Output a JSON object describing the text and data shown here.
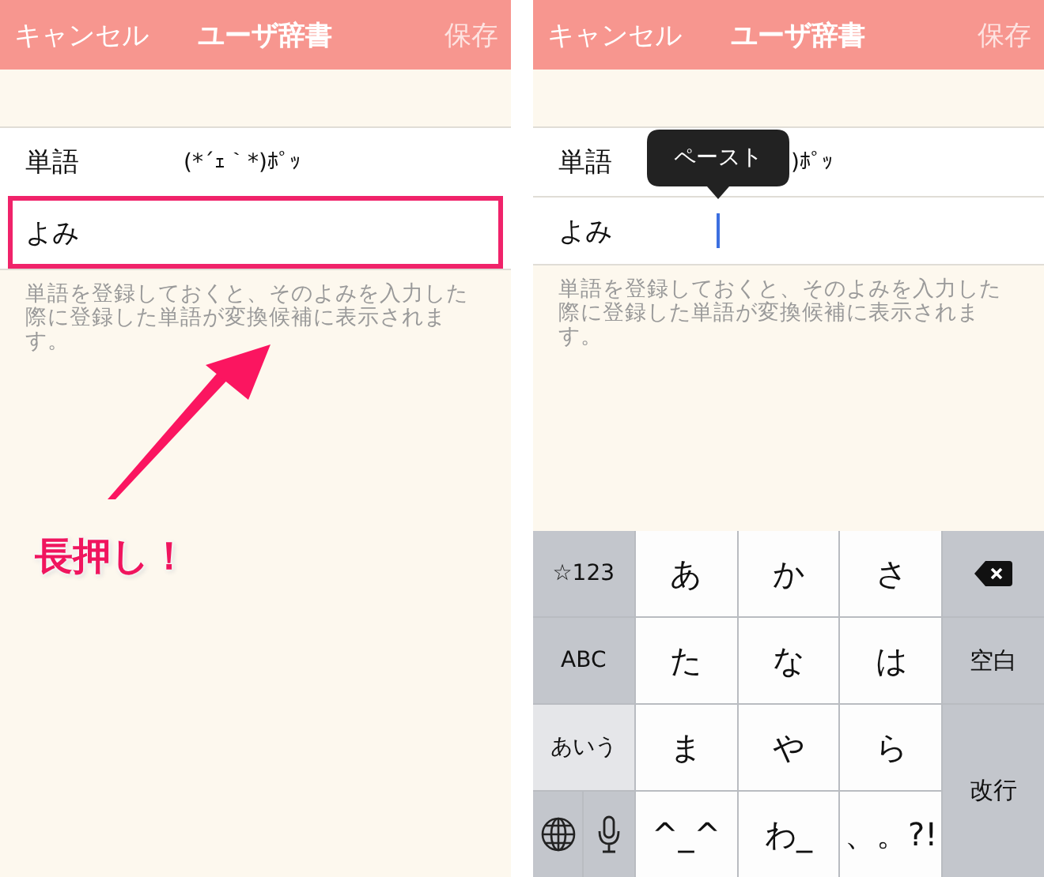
{
  "screens": [
    {
      "nav": {
        "cancel": "キャンセル",
        "title": "ユーザ辞書",
        "save": "保存",
        "save_disabled": true
      },
      "fields": [
        {
          "label": "単語",
          "value": "(*´ｪ｀*)ﾎﾟｯ",
          "highlighted": false,
          "focused": false
        },
        {
          "label": "よみ",
          "highlighted": true,
          "focused": false
        }
      ],
      "note": "単語を登録しておくと、そのよみを入力した際に登録した単語が変換候補に表示されます。",
      "annotation": {
        "label": "長押し！"
      }
    },
    {
      "nav": {
        "cancel": "キャンセル",
        "title": "ユーザ辞書",
        "save": "保存",
        "save_disabled": true
      },
      "paste_menu": {
        "label": "ペースト"
      },
      "fields": [
        {
          "label": "単語",
          "value": ")ﾎﾟｯ",
          "highlighted": false,
          "focused": false
        },
        {
          "label": "よみ",
          "highlighted": false,
          "focused": true
        }
      ],
      "note": "単語を登録しておくと、そのよみを入力した際に登録した単語が変換候補に表示されます。",
      "keyboard": {
        "keys": [
          {
            "kind": "fn",
            "label": "☆123",
            "selected": false
          },
          {
            "kind": "kana",
            "label": "あ"
          },
          {
            "kind": "kana",
            "label": "か"
          },
          {
            "kind": "kana",
            "label": "さ"
          },
          {
            "kind": "delete"
          },
          {
            "kind": "fn",
            "label": "ABC",
            "selected": false
          },
          {
            "kind": "kana",
            "label": "た"
          },
          {
            "kind": "kana",
            "label": "な"
          },
          {
            "kind": "kana",
            "label": "は"
          },
          {
            "kind": "action",
            "label": "空白"
          },
          {
            "kind": "fn",
            "label": "あいう",
            "selected": true
          },
          {
            "kind": "kana",
            "label": "ま"
          },
          {
            "kind": "kana",
            "label": "や"
          },
          {
            "kind": "kana",
            "label": "ら"
          },
          {
            "kind": "return",
            "label": "改行"
          },
          {
            "kind": "globe"
          },
          {
            "kind": "mic"
          },
          {
            "kind": "kana",
            "label": "^_^"
          },
          {
            "kind": "kana",
            "label": "わ_"
          },
          {
            "kind": "kana",
            "label": "、。?!"
          }
        ]
      }
    }
  ]
}
